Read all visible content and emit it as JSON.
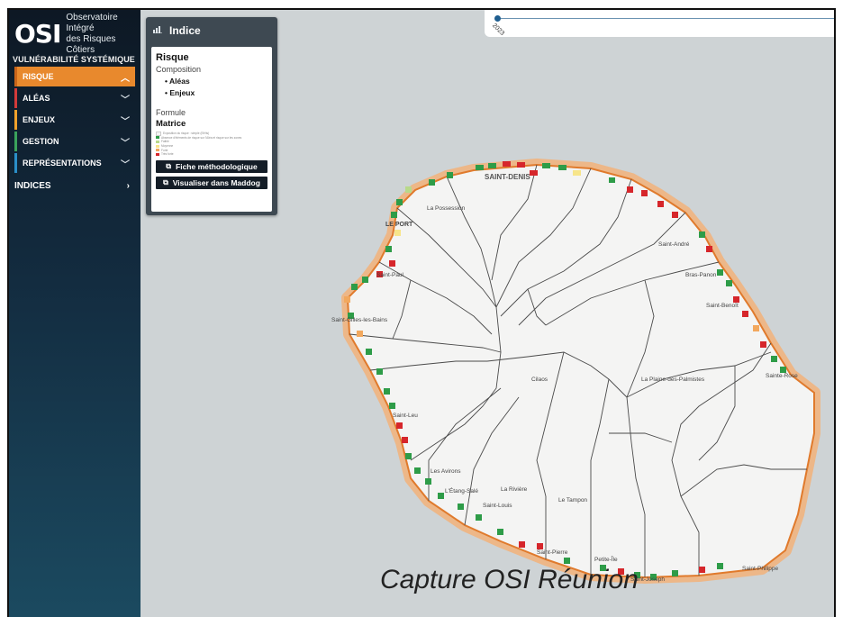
{
  "sidebar": {
    "logo_mark": "OSI",
    "logo_line1": "Observatoire Intégré",
    "logo_line2": "des Risques Côtiers",
    "section_title": "VULNÉRABILITÉ SYSTÉMIQUE",
    "items": [
      {
        "label": "RISQUE",
        "color": "#e8892d",
        "active": true
      },
      {
        "label": "ALÉAS",
        "color": "#d23a3a"
      },
      {
        "label": "ENJEUX",
        "color": "#f0a22b"
      },
      {
        "label": "GESTION",
        "color": "#3aa35c"
      },
      {
        "label": "REPRÉSENTATIONS",
        "color": "#2a8fc9"
      }
    ],
    "indices_label": "INDICES"
  },
  "panel": {
    "header": "Indice",
    "title": "Risque",
    "composition_label": "Composition",
    "composition": [
      "Aléas",
      "Enjeux"
    ],
    "formule_label": "Formule",
    "matrice_label": "Matrice",
    "legend": [
      {
        "text": "Exposition du risque : simple (EtHis)",
        "color": "#f4f4f4"
      },
      {
        "text": "Absence d'éléments de risque sur l'Aléa et risque sur les zones",
        "color": "#2e9c48"
      },
      {
        "text": "Faible",
        "color": "#b8d98a"
      },
      {
        "text": "Moyenne",
        "color": "#f7e58a"
      },
      {
        "text": "Forte",
        "color": "#f2a85e"
      },
      {
        "text": "Très forte",
        "color": "#d6262b"
      }
    ],
    "btn_fiche": "Fiche méthodologique",
    "btn_maddog": "Visualiser dans Maddog"
  },
  "timeline": {
    "year": "2023"
  },
  "map": {
    "places": {
      "saint_denis": "SAINT-DENIS",
      "la_possession": "La Possession",
      "le_port": "LE PORT",
      "saint_andre": "Saint-André",
      "bras_panon": "Bras-Panon",
      "saint_benoit": "Saint-Benoît",
      "saint_paul": "Saint-Paul",
      "saint_gilles": "Saint-Gilles-les-Bains",
      "cilaos": "Cilaos",
      "plaine_palmistes": "La Plaine-des-Palmistes",
      "sainte_rose": "Sainte-Rose",
      "saint_leu": "Saint-Leu",
      "les_avirons": "Les Avirons",
      "etang_sale": "L'Étang-Salé",
      "la_riviere": "La Rivière",
      "saint_louis": "Saint-Louis",
      "le_tampon": "Le Tampon",
      "saint_pierre": "Saint-Pierre",
      "petite_ile": "Petite-Île",
      "saint_joseph": "Saint-Joseph",
      "saint_philippe": "Saint-Philippe"
    }
  },
  "caption": "Capture OSI Réunion",
  "colors": {
    "land": "#f4f4f3",
    "sea": "#ced3d5",
    "route": "#4a4a4a",
    "buffer": "#f2b27a"
  }
}
